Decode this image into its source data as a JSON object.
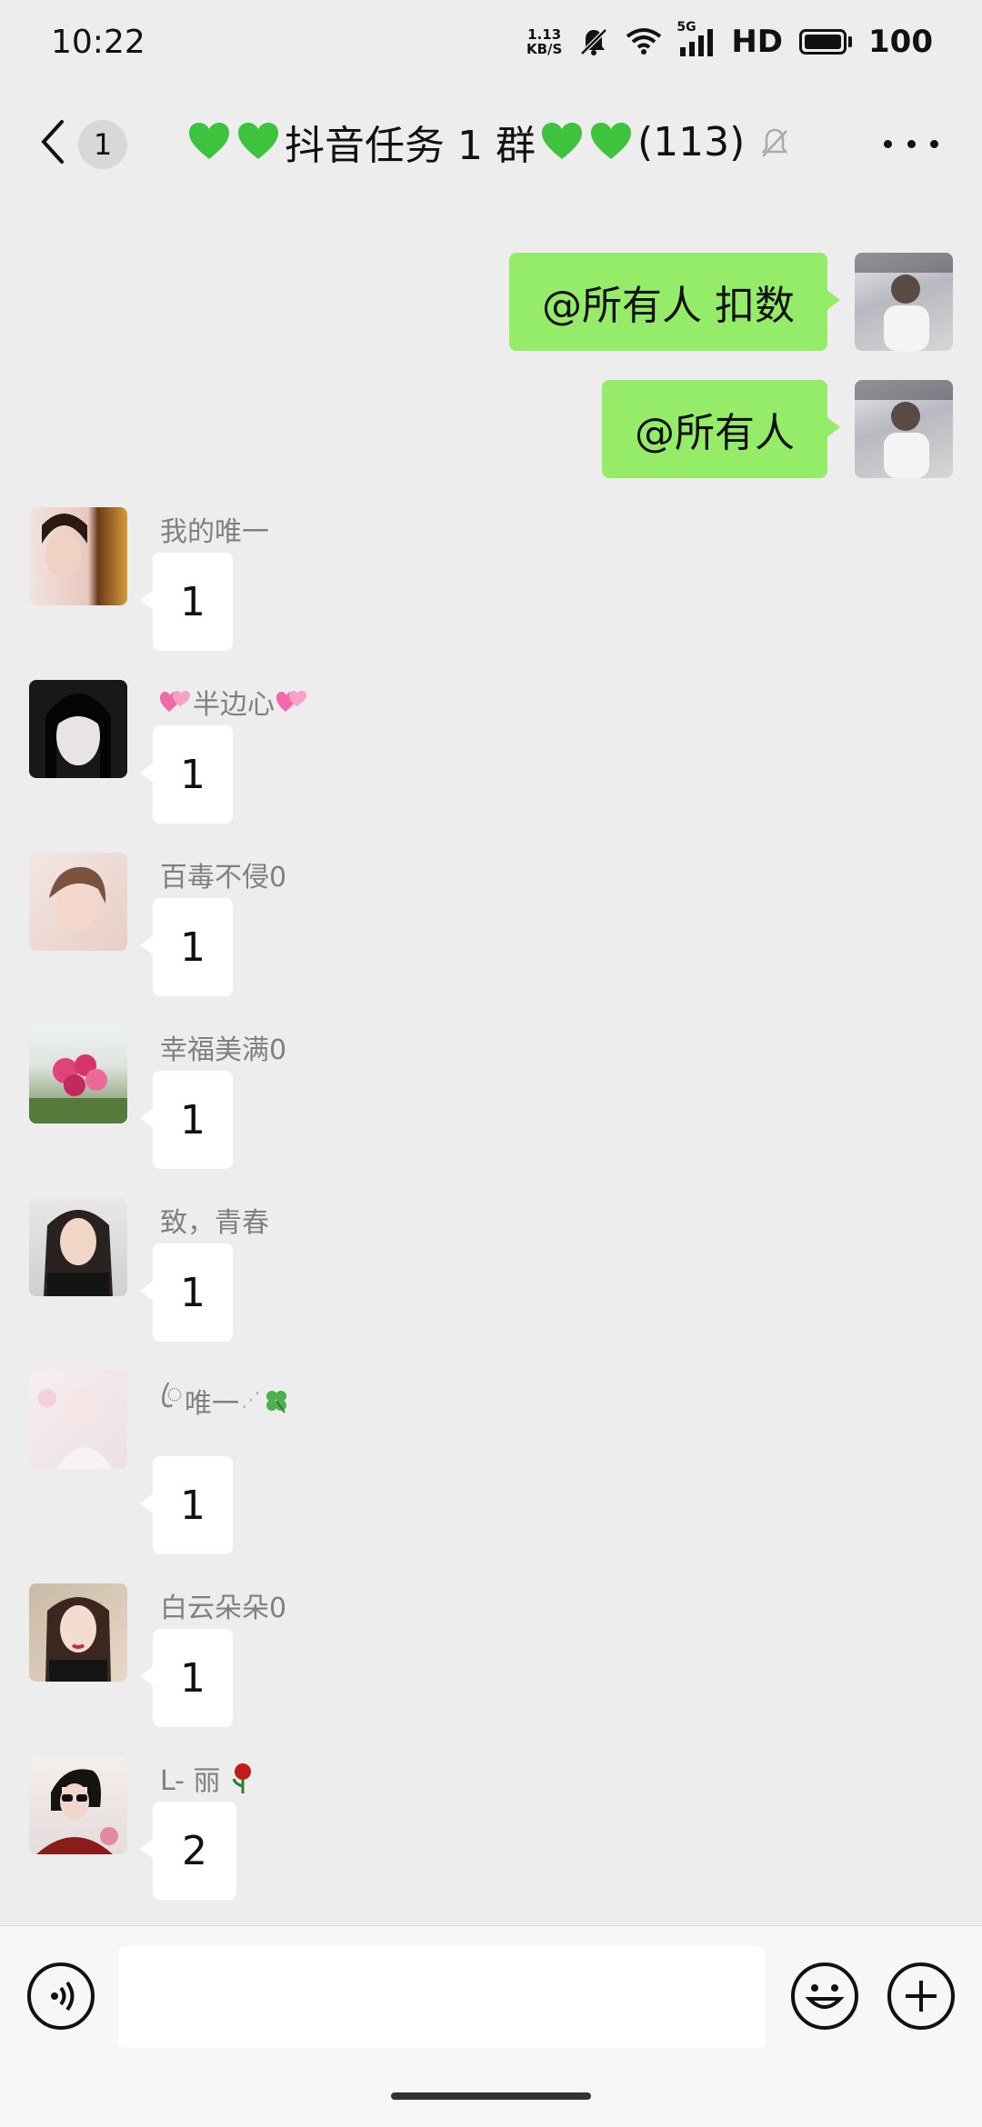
{
  "status_bar": {
    "time": "10:22",
    "net_speed_value": "1.13",
    "net_speed_unit": "KB/S",
    "signal_label": "5G",
    "hd_label": "HD",
    "battery": "100"
  },
  "header": {
    "unread_count": "1",
    "title_text": "抖音任务 1 群",
    "member_count": "(113)",
    "title_decoration_icon": "green-heart-icon",
    "heart_color": "#3ec33e"
  },
  "messages": {
    "outgoing": [
      {
        "text": "@所有人  扣数"
      },
      {
        "text": "@所有人"
      }
    ],
    "incoming": [
      {
        "sender": "我的唯一",
        "text": "1"
      },
      {
        "sender": "半边心",
        "text": "1"
      },
      {
        "sender": "百毒不侵0",
        "text": "1"
      },
      {
        "sender": "幸福美满0",
        "text": "1"
      },
      {
        "sender": "致，青春",
        "text": "1"
      },
      {
        "sender": "唯一",
        "text": "1"
      },
      {
        "sender": "白云朵朵0",
        "text": "1"
      },
      {
        "sender": "L- 丽",
        "text": "2"
      }
    ]
  },
  "colors": {
    "outgoing_bubble": "#95ec69",
    "incoming_bubble": "#ffffff",
    "background": "#ededed"
  }
}
